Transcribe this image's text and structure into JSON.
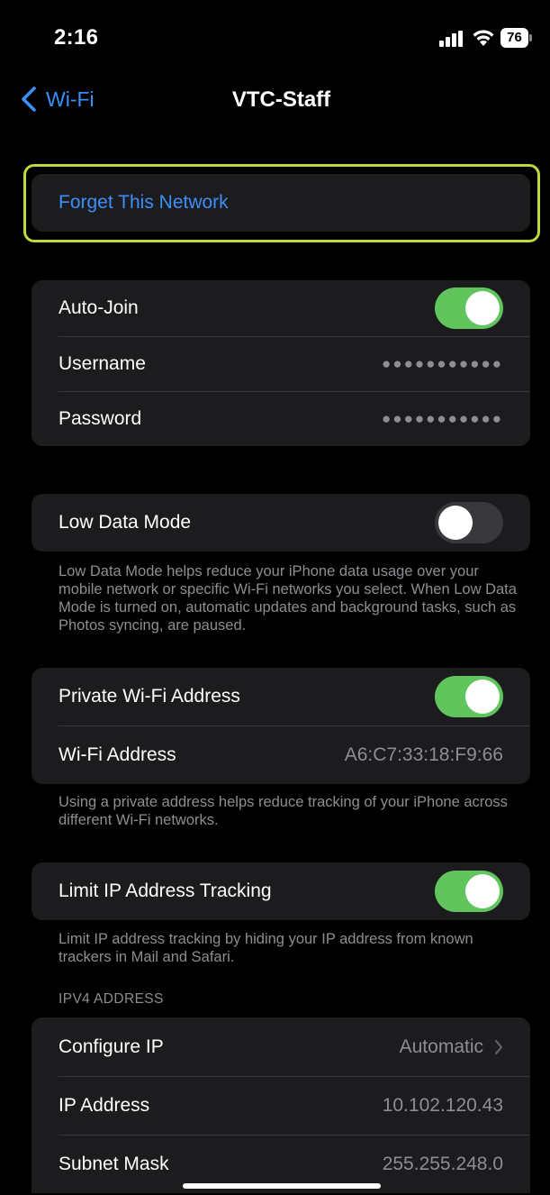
{
  "status_bar": {
    "time": "2:16",
    "battery_level": "76",
    "icons": [
      "cellular-signal-icon",
      "wifi-icon",
      "battery-icon"
    ]
  },
  "nav": {
    "back_label": "Wi-Fi",
    "title": "VTC-Staff"
  },
  "forget": {
    "label": "Forget This Network"
  },
  "auth_group": {
    "auto_join_label": "Auto-Join",
    "auto_join_on": true,
    "username_label": "Username",
    "username_value": "●●●●●●●●●●●",
    "password_label": "Password",
    "password_value": "●●●●●●●●●●●"
  },
  "low_data": {
    "label": "Low Data Mode",
    "on": false,
    "footnote": "Low Data Mode helps reduce your iPhone data usage over your mobile network or specific Wi-Fi networks you select. When Low Data Mode is turned on, automatic updates and background tasks, such as Photos syncing, are paused."
  },
  "private_address": {
    "label": "Private Wi-Fi Address",
    "on": true,
    "address_label": "Wi-Fi Address",
    "address_value": "A6:C7:33:18:F9:66",
    "footnote": "Using a private address helps reduce tracking of your iPhone across different Wi-Fi networks."
  },
  "limit_tracking": {
    "label": "Limit IP Address Tracking",
    "on": true,
    "footnote": "Limit IP address tracking by hiding your IP address from known trackers in Mail and Safari."
  },
  "ipv4": {
    "header": "IPV4 ADDRESS",
    "configure_label": "Configure IP",
    "configure_value": "Automatic",
    "ip_label": "IP Address",
    "ip_value": "10.102.120.43",
    "subnet_label": "Subnet Mask",
    "subnet_value": "255.255.248.0"
  },
  "colors": {
    "accent": "#3a8ff8",
    "toggle_on": "#5fc55c",
    "toggle_off": "#39393d",
    "cell_background": "#1c1c1e",
    "highlight_border": "#c3d83b"
  }
}
